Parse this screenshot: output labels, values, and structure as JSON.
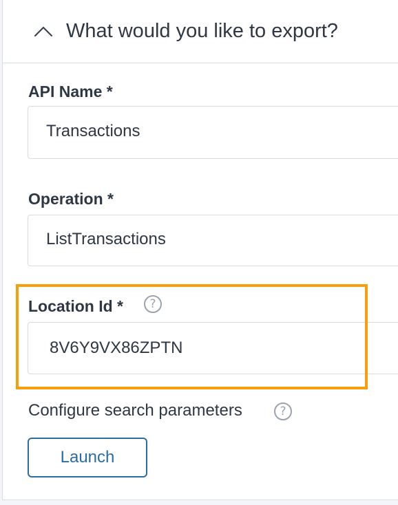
{
  "section": {
    "title": "What would you like to export?",
    "collapse_icon": "chevron-up-icon"
  },
  "fields": {
    "api_name": {
      "label": "API Name *",
      "value": "Transactions"
    },
    "operation": {
      "label": "Operation *",
      "value": "ListTransactions"
    },
    "location_id": {
      "label": "Location Id *",
      "value": "8V6Y9VX86ZPTN",
      "help_icon": "question-circle-icon"
    }
  },
  "config": {
    "text": "Configure search parameters",
    "help_icon": "question-circle-icon"
  },
  "actions": {
    "launch_label": "Launch"
  },
  "colors": {
    "highlight": "#f5a00a",
    "button_accent": "#2b6ca3",
    "text": "#2e3744",
    "border": "#d6dbe1"
  }
}
